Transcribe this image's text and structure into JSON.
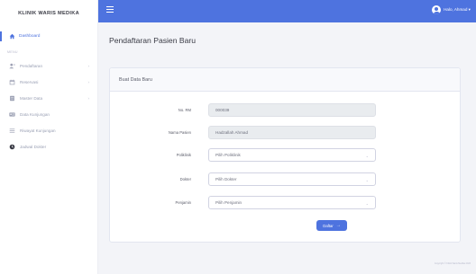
{
  "brand": "KLINIK WARIS MEDIKA",
  "sidebar": {
    "active": {
      "label": "Dashboard",
      "icon": "home-icon"
    },
    "section_label": "MENU",
    "items": [
      {
        "label": "Pendaftaran",
        "icon": "user-plus-icon",
        "has_chevron": true
      },
      {
        "label": "Reservasi",
        "icon": "calendar-icon",
        "has_chevron": true
      },
      {
        "label": "Master Data",
        "icon": "database-icon",
        "has_chevron": true
      },
      {
        "label": "Data Kunjungan",
        "icon": "id-card-icon",
        "has_chevron": false
      },
      {
        "label": "Riwayat Kunjungan",
        "icon": "list-icon",
        "has_chevron": false
      },
      {
        "label": "Jadwal Dokter",
        "icon": "clock-icon",
        "has_chevron": false
      }
    ]
  },
  "topbar": {
    "user_name": "Halo, Ahmad ▾",
    "accent_color": "#4e73df"
  },
  "page": {
    "title": "Pendaftaran Pasien Baru"
  },
  "card": {
    "header": "Buat Data Baru"
  },
  "form": {
    "no_rm": {
      "label": "No. RM",
      "value": "000039"
    },
    "nama_pasien": {
      "label": "Nama Pasien",
      "value": "Hadzallah Ahmad"
    },
    "poliklinik": {
      "label": "Poliklinik",
      "selected": "Pilih Poliklinik"
    },
    "dokter": {
      "label": "Dokter",
      "selected": "Pilih Dokter"
    },
    "penjamin": {
      "label": "Penjamin",
      "selected": "Pilih Penjamin"
    },
    "submit_label": "Daftar"
  },
  "footer": {
    "note": "Copyright © Klinik Waris Medika 2023"
  }
}
